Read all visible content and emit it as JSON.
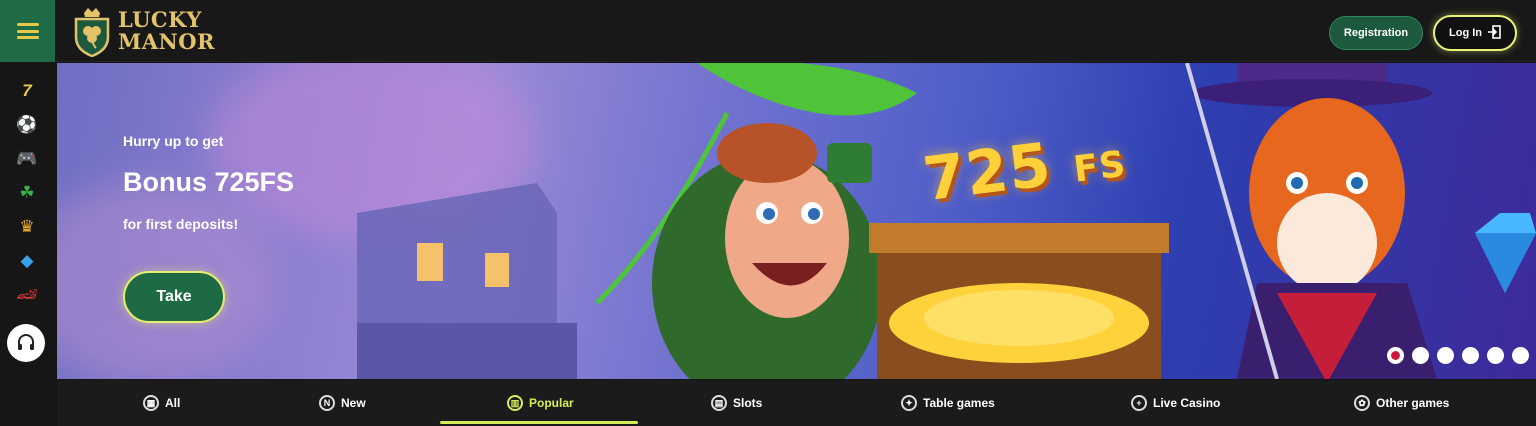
{
  "header": {
    "brand_line1": "LUCKY",
    "brand_line2": "MANOR",
    "registration_label": "Registration",
    "login_label": "Log In"
  },
  "sidebar": {
    "items": [
      {
        "icon": "seven-icon",
        "glyph": "7"
      },
      {
        "icon": "soccer-ball-icon",
        "glyph": "⚽"
      },
      {
        "icon": "gamepad-icon",
        "glyph": "🎮"
      },
      {
        "icon": "clover-icon",
        "glyph": "☘"
      },
      {
        "icon": "crown-icon",
        "glyph": "♛"
      },
      {
        "icon": "gem-icon",
        "glyph": "◆"
      },
      {
        "icon": "racing-car-icon",
        "glyph": "🏎"
      }
    ],
    "support_icon": "headset-icon"
  },
  "banner": {
    "line1": "Hurry up to get",
    "title": "Bonus 725FS",
    "line3": "for first deposits!",
    "cta_label": "Take",
    "art_number": "725",
    "art_suffix": "FS",
    "slides_total": 6,
    "active_slide": 1
  },
  "categories": [
    {
      "label": "All",
      "icon": "grid-icon"
    },
    {
      "label": "New",
      "icon": "new-icon"
    },
    {
      "label": "Popular",
      "icon": "popular-icon",
      "active": true
    },
    {
      "label": "Slots",
      "icon": "slots-icon"
    },
    {
      "label": "Table games",
      "icon": "table-games-icon"
    },
    {
      "label": "Live Casino",
      "icon": "live-casino-icon"
    },
    {
      "label": "Other games",
      "icon": "other-games-icon"
    }
  ],
  "colors": {
    "accent_green": "#1f6b45",
    "accent_yellow": "#e5ee6f",
    "brand_gold": "#e2c36a",
    "active_dot": "#d2143b"
  }
}
